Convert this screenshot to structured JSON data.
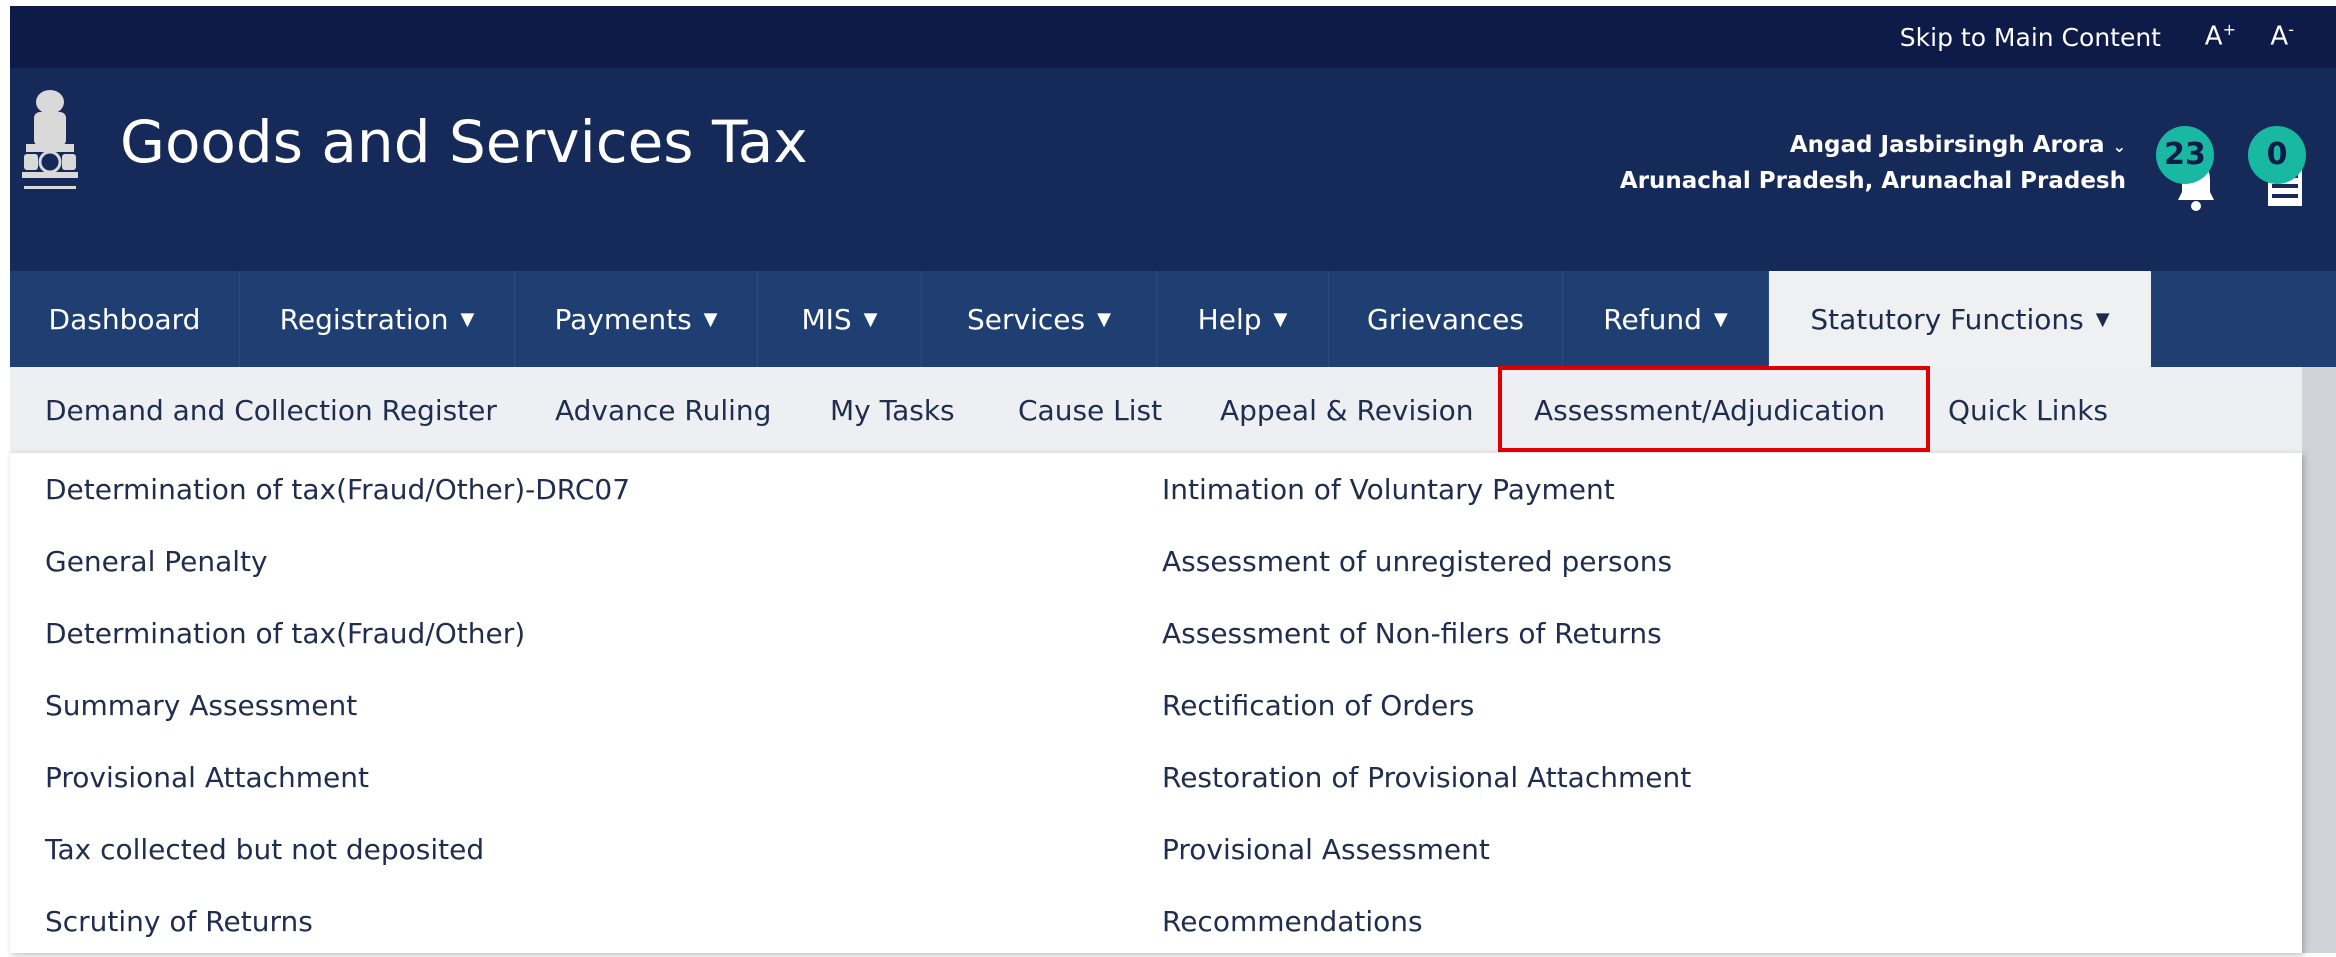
{
  "topbar": {
    "skip_label": "Skip to Main Content",
    "font_increase": "A",
    "font_increase_sup": "+",
    "font_decrease": "A",
    "font_decrease_sup": "-"
  },
  "header": {
    "title": "Goods and Services Tax",
    "user_name": "Angad Jasbirsingh Arora",
    "user_location": "Arunachal Pradesh, Arunachal Pradesh",
    "notifications_count": "23",
    "documents_count": "0"
  },
  "nav": {
    "items": [
      {
        "label": "Dashboard"
      },
      {
        "label": "Registration"
      },
      {
        "label": "Payments"
      },
      {
        "label": "MIS"
      },
      {
        "label": "Services"
      },
      {
        "label": "Help"
      },
      {
        "label": "Grievances"
      },
      {
        "label": "Refund"
      },
      {
        "label": "Statutory Functions"
      }
    ],
    "active_item": "Statutory Functions"
  },
  "subnav": {
    "items": [
      {
        "label": "Demand and Collection Register"
      },
      {
        "label": "Advance Ruling"
      },
      {
        "label": "My Tasks"
      },
      {
        "label": "Cause List"
      },
      {
        "label": "Appeal & Revision"
      },
      {
        "label": "Assessment/Adjudication"
      },
      {
        "label": "Quick Links"
      }
    ],
    "highlighted_item": "Assessment/Adjudication"
  },
  "menu": {
    "left_column": [
      "Determination of tax(Fraud/Other)-DRC07",
      "General Penalty",
      "Determination of tax(Fraud/Other)",
      "Summary Assessment",
      "Provisional Attachment",
      "Tax collected but not deposited",
      "Scrutiny of Returns"
    ],
    "right_column": [
      "Intimation of Voluntary Payment",
      "Assessment of unregistered persons",
      "Assessment of Non-filers of Returns",
      "Rectification of Orders",
      "Restoration of Provisional Attachment",
      "Provisional Assessment",
      "Recommendations"
    ]
  },
  "colors": {
    "topstrip": "#0e1a47",
    "header": "#162a59",
    "nav": "#1f3f73",
    "subnav": "#edeff2",
    "badge": "#18b8a2",
    "highlight": "#e00000"
  }
}
